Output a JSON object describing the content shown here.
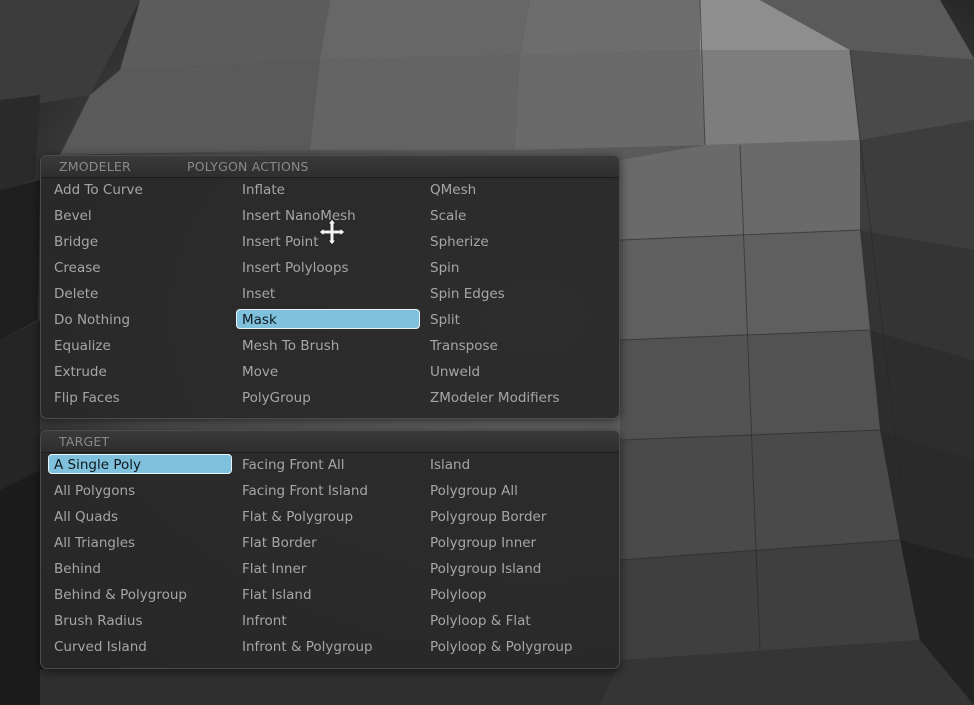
{
  "zmodeler_menu": {
    "tab_title": "ZMODELER",
    "section_title": "POLYGON ACTIONS",
    "selected": "Mask",
    "columns": [
      [
        "Add To Curve",
        "Bevel",
        "Bridge",
        "Crease",
        "Delete",
        "Do Nothing",
        "Equalize",
        "Extrude",
        "Flip Faces"
      ],
      [
        "Inflate",
        "Insert NanoMesh",
        "Insert Point",
        "Insert Polyloops",
        "Inset",
        "Mask",
        "Mesh To Brush",
        "Move",
        "PolyGroup"
      ],
      [
        "QMesh",
        "Scale",
        "Spherize",
        "Spin",
        "Spin Edges",
        "Split",
        "Transpose",
        "Unweld",
        "ZModeler Modifiers"
      ]
    ]
  },
  "target_menu": {
    "section_title": "TARGET",
    "selected": "A Single Poly",
    "columns": [
      [
        "A Single Poly",
        "All Polygons",
        "All Quads",
        "All Triangles",
        "Behind",
        "Behind & Polygroup",
        "Brush Radius",
        "Curved Island"
      ],
      [
        "Facing Front All",
        "Facing Front Island",
        "Flat & Polygroup",
        "Flat Border",
        "Flat Inner",
        "Flat Island",
        "Infront",
        "Infront & Polygroup"
      ],
      [
        "Island",
        "Polygroup All",
        "Polygroup Border",
        "Polygroup Inner",
        "Polygroup Island",
        "Polyloop",
        "Polyloop & Flat",
        "Polyloop & Polygroup"
      ]
    ]
  },
  "colors": {
    "selection_fill": "#7fc1dc",
    "panel_bg": "#2a2a2a",
    "item_text": "#a6a6a6",
    "header_text": "#8a8a8a"
  },
  "icons": {
    "cursor": "move-cursor-icon"
  }
}
